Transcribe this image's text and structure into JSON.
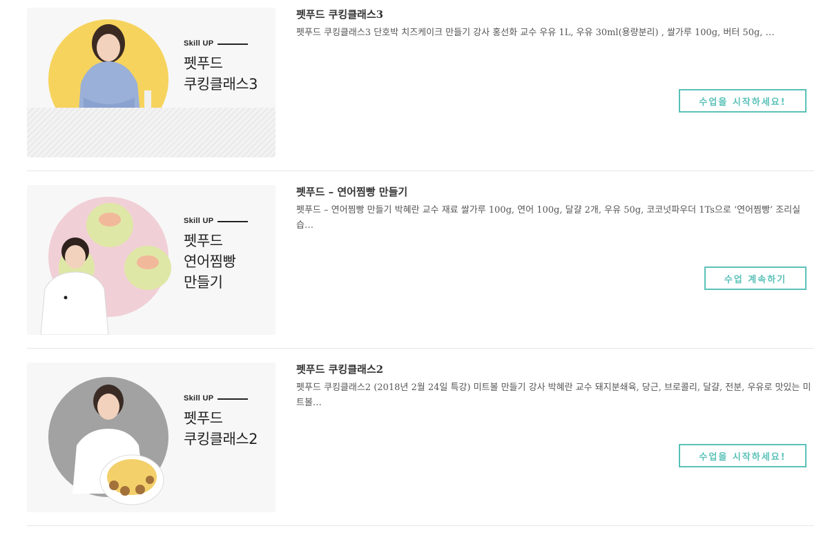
{
  "courses": [
    {
      "thumb_skill": "Skill UP",
      "thumb_title_lines": [
        "펫푸드",
        "쿠킹클래스3"
      ],
      "title": "펫푸드 쿠킹클래스3",
      "description": "펫푸드 쿠킹클래스3   단호박 치즈케이크 만들기   강사 홍선화 교수    우유 1L, 우유 30ml(용량분리) , 쌀가루 100g, 버터 50g, …",
      "button": "수업을 시작하세요!",
      "colors": {
        "circle": "#f6d35d"
      }
    },
    {
      "thumb_skill": "Skill UP",
      "thumb_title_lines": [
        "펫푸드",
        "연어찜빵",
        "만들기"
      ],
      "title": "펫푸드 – 연어찜빵 만들기",
      "description": "펫푸드 – 연어찜빵 만들기 박혜란 교수    재료 쌀가루 100g, 연어 100g, 달걀 2개, 우유 50g, 코코넛파우더 1Ts으로 ‘연어찜빵’ 조리실습…",
      "button": "수업 계속하기",
      "colors": {
        "circle": "#f1cfd6"
      }
    },
    {
      "thumb_skill": "Skill UP",
      "thumb_title_lines": [
        "펫푸드",
        "쿠킹클래스2"
      ],
      "title": "펫푸드 쿠킹클래스2",
      "description": "펫푸드 쿠킹클래스2 (2018년 2월 24일 특강) 미트볼 만들기 강사 박혜란 교수    돼지분쇄육, 당근, 브로콜리, 달걀, 전분, 우유로 맛있는 미트볼…",
      "button": "수업을 시작하세요!",
      "colors": {
        "circle": "#9a9a9a"
      }
    }
  ],
  "colors": {
    "accent": "#5ac1b8",
    "title_text": "#333333",
    "desc_text": "#555555"
  }
}
